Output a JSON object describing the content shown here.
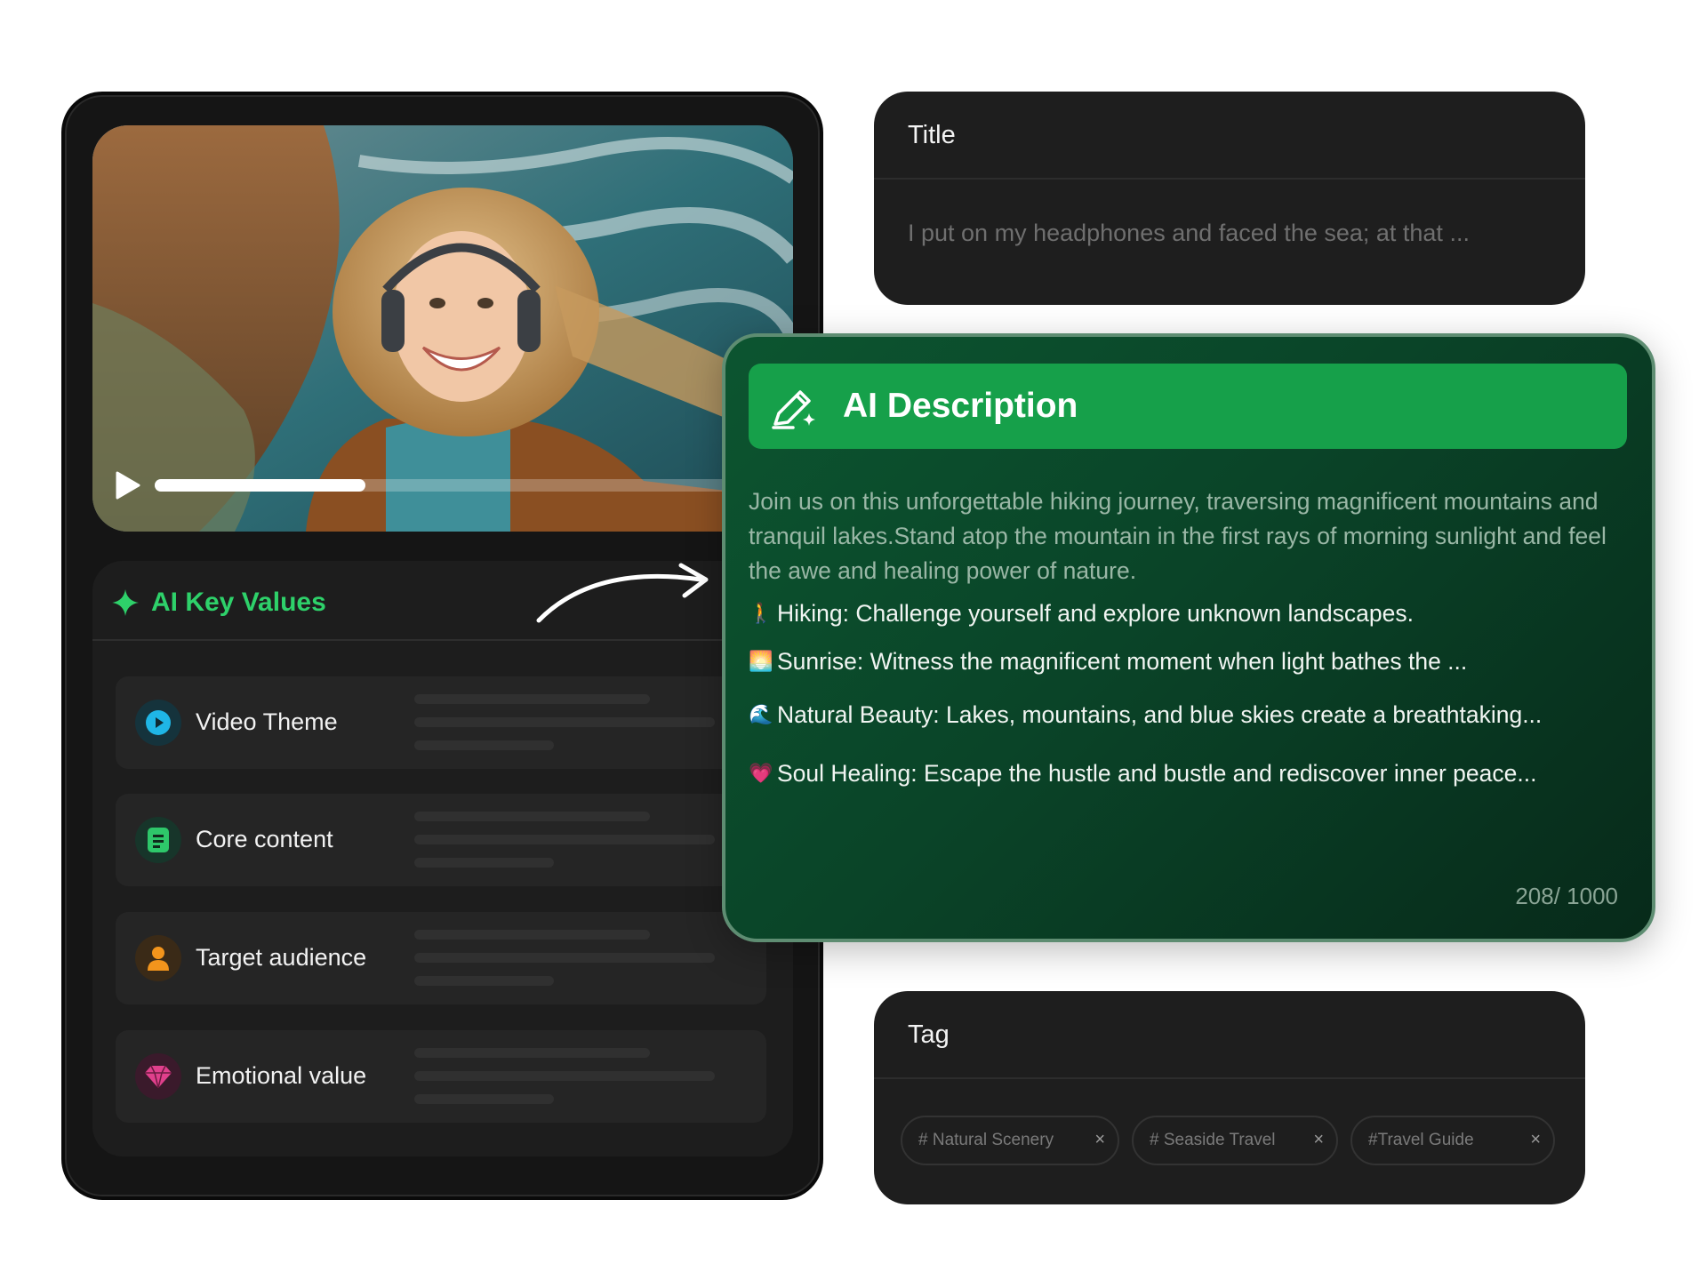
{
  "video": {
    "progress_fraction": 0.32
  },
  "key_values": {
    "title": "AI Key Values",
    "items": [
      {
        "label": "Video Theme",
        "icon": "play-circle-icon",
        "color": "#1fb6e6"
      },
      {
        "label": "Core content",
        "icon": "document-icon",
        "color": "#2ec76a"
      },
      {
        "label": "Target audience",
        "icon": "user-icon",
        "color": "#f2941c"
      },
      {
        "label": "Emotional value",
        "icon": "gem-icon",
        "color": "#e0408c"
      }
    ]
  },
  "title_card": {
    "label": "Title",
    "value": "I put on my headphones and faced the sea; at that ..."
  },
  "ai_description": {
    "title": "AI Description",
    "intro": "Join us on this unforgettable hiking journey, traversing magnificent mountains and tranquil lakes.Stand atop the mountain in the first rays of morning sunlight and feel the awe and healing power of nature.",
    "bullets": [
      {
        "emoji": "🚶",
        "text": "Hiking: Challenge yourself and explore unknown landscapes."
      },
      {
        "emoji": "🌅",
        "text": "Sunrise: Witness the magnificent moment when light bathes the ..."
      },
      {
        "emoji": "🌊",
        "text": "Natural Beauty: Lakes, mountains, and blue skies create a breathtaking..."
      },
      {
        "emoji": "💗",
        "text": "Soul Healing: Escape the hustle and bustle and rediscover inner peace..."
      }
    ],
    "char_count": "208/ 1000"
  },
  "tag_card": {
    "label": "Tag",
    "tags": [
      "# Natural Scenery",
      "# Seaside Travel",
      "#Travel Guide"
    ],
    "remove_symbol": "×"
  },
  "colors": {
    "accent_green": "#2ed16a",
    "header_green": "#16a04a",
    "card_bg": "#1e1e1e",
    "panel_dark": "#151515"
  }
}
